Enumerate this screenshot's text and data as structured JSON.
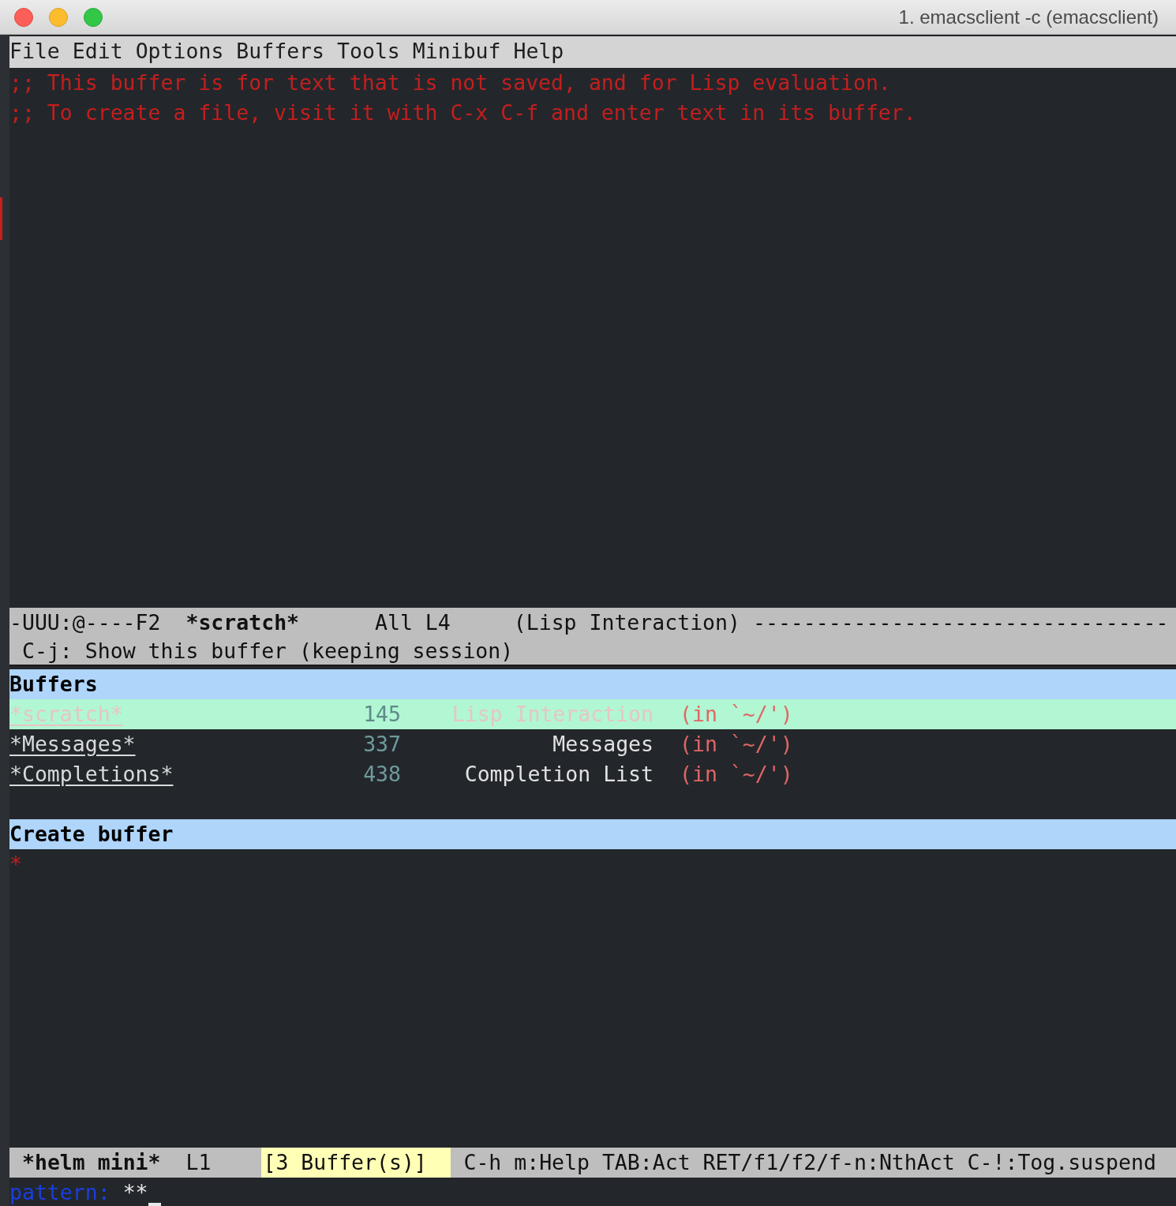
{
  "window": {
    "title": "1. emacsclient -c (emacsclient)"
  },
  "menu": [
    "File",
    "Edit",
    "Options",
    "Buffers",
    "Tools",
    "Minibuf",
    "Help"
  ],
  "editor": {
    "lines": [
      ";; This buffer is for text that is not saved, and for Lisp evaluation.",
      ";; To create a file, visit it with C-x C-f and enter text in its buffer."
    ]
  },
  "mode_line": {
    "status": "-UUU:@----F2",
    "buffer_name": "*scratch*",
    "position": "All L4",
    "mode": "(Lisp Interaction)",
    "fill": "---------------------------------"
  },
  "helm_header": "C-j: Show this buffer (keeping session)",
  "buffers_source": {
    "title": "Buffers",
    "rows": [
      {
        "name": "*scratch*",
        "size": "145",
        "mode": "Lisp Interaction",
        "directory": "(in `~/')",
        "selected": true
      },
      {
        "name": "*Messages*",
        "size": "337",
        "mode": "Messages",
        "directory": "(in `~/')",
        "selected": false
      },
      {
        "name": "*Completions*",
        "size": "438",
        "mode": "Completion List",
        "directory": "(in `~/')",
        "selected": false
      }
    ]
  },
  "create_source": {
    "title": "Create buffer",
    "candidate": "*"
  },
  "helm_mode_line": {
    "name": "*helm mini*",
    "line": "L1",
    "count": "[3 Buffer(s)]",
    "keys": "C-h m:Help TAB:Act RET/f1/f2/f-n:NthAct C-!:Tog.suspend"
  },
  "minibuffer": {
    "prompt": "pattern:",
    "value": "**"
  }
}
